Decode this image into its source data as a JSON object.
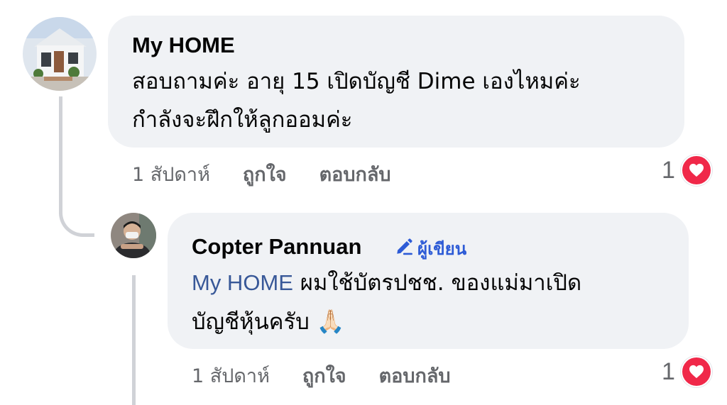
{
  "colors": {
    "bubble": "#f0f2f5",
    "mention": "#385898",
    "author_badge": "#2d5bd6",
    "meta_text": "#65676b",
    "heart": "#f02849",
    "thread_line": "#d0d2d7"
  },
  "comments": [
    {
      "author": "My HOME",
      "body_lines": [
        "สอบถามค่ะ อายุ 15 เปิดบัญชี Dime เองไหมค่ะ",
        "กำลังจะฝึกให้ลูกออมค่ะ"
      ],
      "timestamp": "1 สัปดาห์",
      "like_label": "ถูกใจ",
      "reply_label": "ตอบกลับ",
      "reaction_count": "1",
      "reaction_icon": "heart-icon"
    },
    {
      "author": "Copter Pannuan",
      "author_badge": "ผู้เขียน",
      "author_badge_icon": "pencil-icon",
      "mention": "My HOME",
      "body_line1_rest": " ผมใช้บัตรปชช. ของแม่มาเปิด",
      "body_line2": "บัญชีหุ้นครับ",
      "body_emoji": "🙏🏻",
      "timestamp": "1 สัปดาห์",
      "like_label": "ถูกใจ",
      "reply_label": "ตอบกลับ",
      "reaction_count": "1",
      "reaction_icon": "heart-icon"
    }
  ]
}
